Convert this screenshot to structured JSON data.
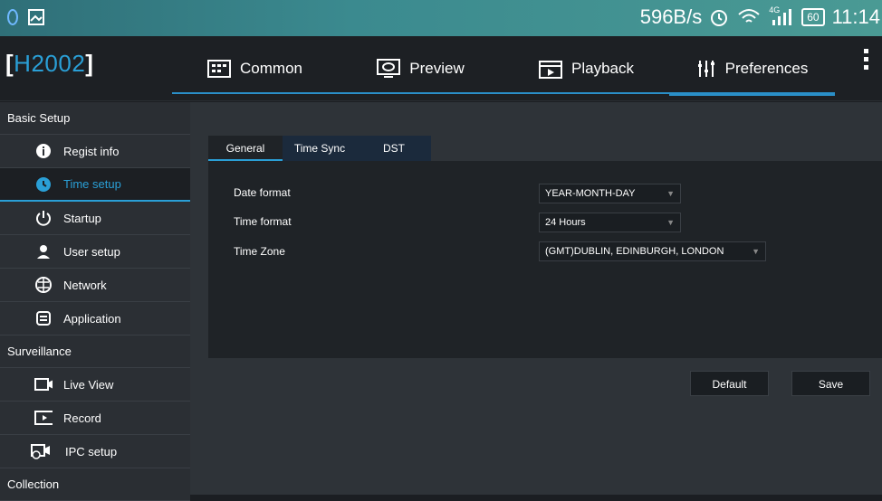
{
  "status_bar": {
    "speed": "596B/s",
    "network_type": "4G",
    "battery": "60",
    "time": "11:14"
  },
  "app": {
    "brand": "H2002",
    "brand_color": "#2a9fd6"
  },
  "top_tabs": [
    {
      "label": "Common",
      "icon": "common-icon"
    },
    {
      "label": "Preview",
      "icon": "preview-icon"
    },
    {
      "label": "Playback",
      "icon": "playback-icon"
    },
    {
      "label": "Preferences",
      "icon": "preferences-icon"
    }
  ],
  "sidebar": {
    "sections": [
      {
        "title": "Basic Setup",
        "items": [
          {
            "label": "Regist info",
            "icon": "info-icon"
          },
          {
            "label": "Time setup",
            "icon": "clock-icon"
          },
          {
            "label": "Startup",
            "icon": "power-icon"
          },
          {
            "label": "User setup",
            "icon": "user-icon"
          },
          {
            "label": "Network",
            "icon": "network-icon"
          },
          {
            "label": "Application",
            "icon": "application-icon"
          }
        ]
      },
      {
        "title": "Surveillance",
        "items": [
          {
            "label": "Live View",
            "icon": "camera-icon"
          },
          {
            "label": "Record",
            "icon": "record-icon"
          },
          {
            "label": "IPC setup",
            "icon": "ipc-icon"
          }
        ]
      },
      {
        "title": "Collection",
        "items": []
      }
    ]
  },
  "sub_tabs": [
    "General",
    "Time Sync",
    "DST"
  ],
  "settings": {
    "date_format_label": "Date format",
    "date_format_value": "YEAR-MONTH-DAY",
    "time_format_label": "Time format",
    "time_format_value": "24 Hours",
    "time_zone_label": "Time Zone",
    "time_zone_value": "(GMT)DUBLIN, EDINBURGH, LONDON"
  },
  "buttons": {
    "default_label": "Default",
    "save_label": "Save"
  }
}
